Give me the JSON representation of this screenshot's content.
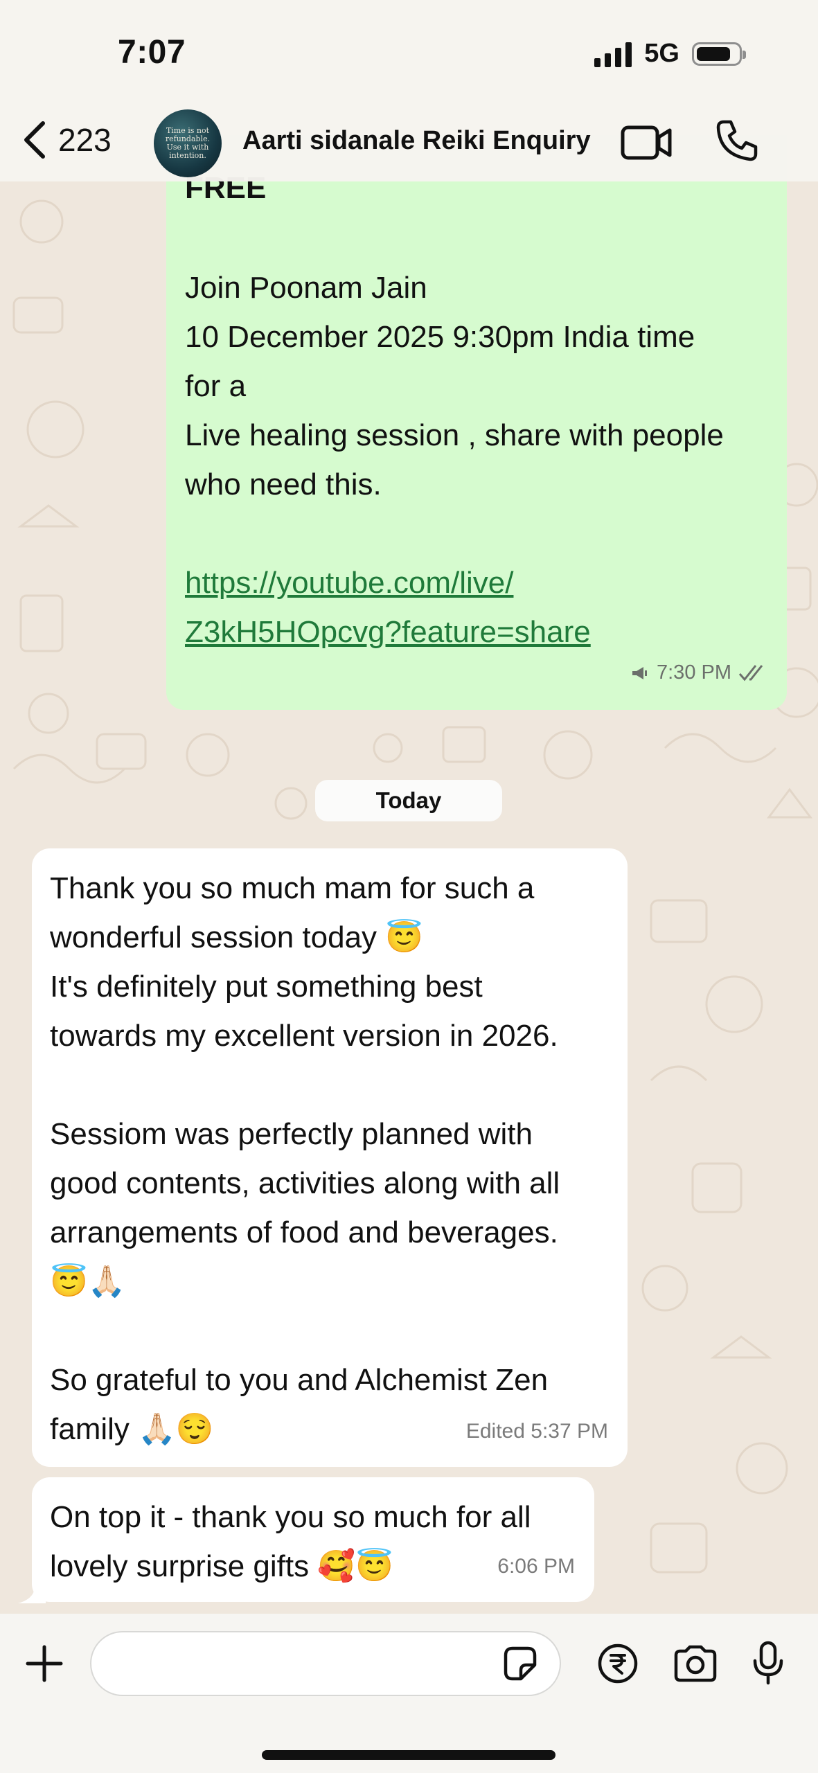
{
  "status": {
    "time": "7:07",
    "network": "5G"
  },
  "header": {
    "back_count": "223",
    "contact_name": "Aarti sidanale Reiki Enquiry",
    "avatar_text": "Time is not refundable. Use it with intention."
  },
  "messages": {
    "outgoing": {
      "top_text": "FREE",
      "lines": [
        "Join Poonam Jain",
        "10 December 2025 9:30pm India time",
        "for a",
        "Live healing session , share with people",
        "who need this."
      ],
      "link_lines": [
        "https://youtube.com/live/",
        "Z3kH5HOpcvg?feature=share"
      ],
      "time": "7:30 PM"
    },
    "date_divider": "Today",
    "incoming1": {
      "p1": "Thank you so much mam for such a\nwonderful session today 😇\nIt's definitely put something best\ntowards my excellent version in 2026.",
      "p2": "Sessiom was perfectly planned with\ngood contents, activities along with all\narrangements of food and beverages.\n😇🙏🏻",
      "p3": "So grateful to you and Alchemist Zen\nfamily 🙏🏻😌",
      "edited_label": "Edited",
      "time": "5:37 PM"
    },
    "incoming2": {
      "text": "On top it - thank you so much for all\nlovely surprise gifts 🥰😇",
      "time": "6:06 PM"
    }
  },
  "composer": {
    "placeholder": ""
  },
  "colors": {
    "outgoing_bubble": "#d6fbcf",
    "incoming_bubble": "#ffffff",
    "link": "#1f7a3a",
    "chat_bg": "#efe7dd"
  }
}
